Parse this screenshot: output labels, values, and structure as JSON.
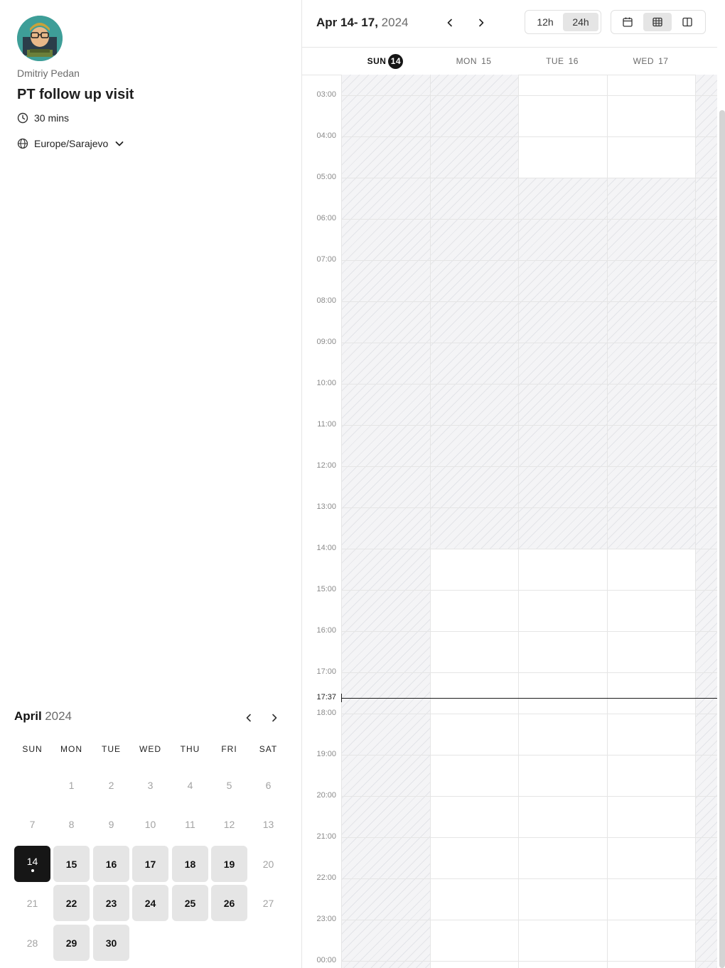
{
  "profile": {
    "host_name": "Dmitriy Pedan",
    "event_title": "PT follow up visit",
    "duration": "30 mins",
    "timezone": "Europe/Sarajevo",
    "avatar_badge": "DEVELOPER"
  },
  "month_calendar": {
    "month": "April",
    "year": "2024",
    "weekdays": [
      "SUN",
      "MON",
      "TUE",
      "WED",
      "THU",
      "FRI",
      "SAT"
    ],
    "leading_blanks": 1,
    "days": [
      "1",
      "2",
      "3",
      "4",
      "5",
      "6",
      "7",
      "8",
      "9",
      "10",
      "11",
      "12",
      "13",
      "14",
      "15",
      "16",
      "17",
      "18",
      "19",
      "20",
      "21",
      "22",
      "23",
      "24",
      "25",
      "26",
      "27",
      "28",
      "29",
      "30"
    ],
    "available_days": [
      "15",
      "16",
      "17",
      "18",
      "19",
      "22",
      "23",
      "24",
      "25",
      "26",
      "29",
      "30"
    ],
    "selected_day": "14"
  },
  "week_view": {
    "range_label": "Apr 14- 17,",
    "range_year": "2024",
    "format_options": [
      "12h",
      "24h"
    ],
    "active_format": "24h",
    "view_icons": [
      "calendar-icon",
      "grid-icon",
      "columns-icon"
    ],
    "active_view": "grid-icon",
    "columns": [
      {
        "dow": "SUN",
        "date": "14",
        "today": true
      },
      {
        "dow": "MON",
        "date": "15",
        "today": false
      },
      {
        "dow": "TUE",
        "date": "16",
        "today": false
      },
      {
        "dow": "WED",
        "date": "17",
        "today": false
      }
    ],
    "hours": [
      "03:00",
      "04:00",
      "05:00",
      "06:00",
      "07:00",
      "08:00",
      "09:00",
      "10:00",
      "11:00",
      "12:00",
      "13:00",
      "14:00",
      "15:00",
      "16:00",
      "17:00",
      "18:00",
      "19:00",
      "20:00",
      "21:00",
      "22:00",
      "23:00",
      "00:00"
    ],
    "current_time": "17:37",
    "unavailable_blocks": [
      {
        "day": "SUN",
        "from": "02:30",
        "to": "24:30"
      },
      {
        "day": "MON",
        "from": "02:30",
        "to": "14:00"
      },
      {
        "day": "TUE",
        "from": "05:00",
        "to": "14:00"
      },
      {
        "day": "WED",
        "from": "05:00",
        "to": "14:00"
      },
      {
        "day": "THU",
        "from": "02:30",
        "to": "24:30"
      }
    ]
  },
  "colors": {
    "accent": "#161616",
    "available_bg": "#e5e5e5",
    "unavailable_stripe": "#e3e4e8",
    "grid_line": "#e5e5e5"
  }
}
